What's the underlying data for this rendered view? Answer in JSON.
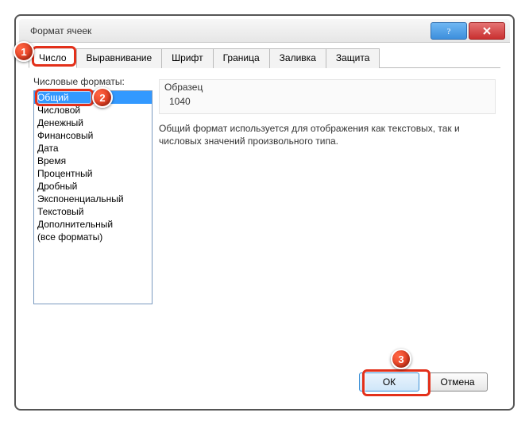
{
  "window": {
    "title": "Формат ячеек"
  },
  "tabs": [
    {
      "label": "Число",
      "active": true
    },
    {
      "label": "Выравнивание"
    },
    {
      "label": "Шрифт"
    },
    {
      "label": "Граница"
    },
    {
      "label": "Заливка"
    },
    {
      "label": "Защита"
    }
  ],
  "left": {
    "label": "Числовые форматы:",
    "items": [
      "Общий",
      "Числовой",
      "Денежный",
      "Финансовый",
      "Дата",
      "Время",
      "Процентный",
      "Дробный",
      "Экспоненциальный",
      "Текстовый",
      "Дополнительный",
      "(все форматы)"
    ],
    "selected_index": 0
  },
  "right": {
    "sample_label": "Образец",
    "sample_value": "1040",
    "description": "Общий формат используется для отображения как текстовых, так и числовых значений произвольного типа."
  },
  "buttons": {
    "ok": "ОК",
    "cancel": "Отмена"
  },
  "markers": {
    "m1": "1",
    "m2": "2",
    "m3": "3"
  }
}
